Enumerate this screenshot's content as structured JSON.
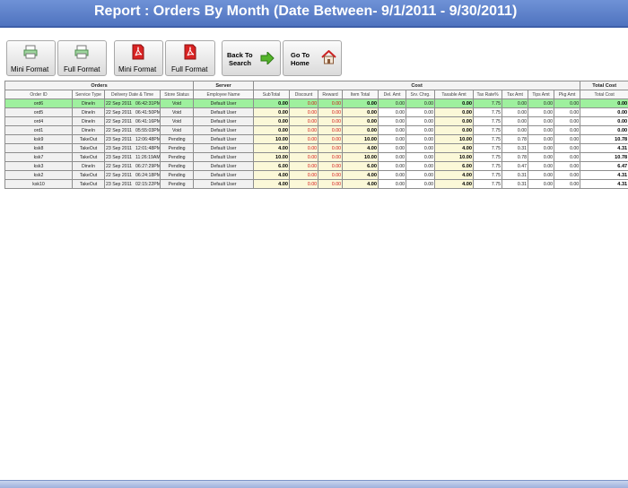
{
  "title": "Report :  Orders By Month (Date Between- 9/1/2011 - 9/30/2011)",
  "toolbar": {
    "buttons": [
      {
        "label": "Mini Format",
        "icon": "printer-icon"
      },
      {
        "label": "Full Format",
        "icon": "printer-icon"
      },
      {
        "label": "Mini Format",
        "icon": "pdf-icon"
      },
      {
        "label": "Full Format",
        "icon": "pdf-icon"
      },
      {
        "label": "Back To Search",
        "line1": "Back To",
        "line2": "Search",
        "icon": "arrow-right-icon"
      },
      {
        "label": "Go To Home",
        "line1": "Go To",
        "line2": "Home",
        "icon": "home-icon"
      }
    ]
  },
  "groups": {
    "orders": "Orders",
    "server": "Server",
    "cost": "Cost",
    "total": "Total Cost"
  },
  "columns": [
    "Order ID",
    "Service Type",
    "Delivery Date & Time",
    "Store Status",
    "Employee Name",
    "SubTotal",
    "Discount",
    "Reward",
    "Item Total",
    "Del. Amt",
    "Srv. Chrg.",
    "Taxable Amt",
    "Tax Rate%",
    "Tax Amt",
    "Tips Amt",
    "Pkg Amt",
    "Total Cost"
  ],
  "rows": [
    {
      "id": "ord6",
      "service": "DineIn",
      "date": "22 Sep 2011",
      "time": "06:42:31PM",
      "status": "Void",
      "employee": "Default User",
      "subtotal": "0.00",
      "discount": "0.00",
      "reward": "0.00",
      "item_total": "0.00",
      "del": "0.00",
      "srv": "0.00",
      "taxable": "0.00",
      "tax_rate": "7.75",
      "tax_amt": "0.00",
      "tips": "0.00",
      "pkg": "0.00",
      "total": "0.00"
    },
    {
      "id": "ord5",
      "service": "DineIn",
      "date": "22 Sep 2011",
      "time": "06:41:50PM",
      "status": "Void",
      "employee": "Default User",
      "subtotal": "0.00",
      "discount": "0.00",
      "reward": "0.00",
      "item_total": "0.00",
      "del": "0.00",
      "srv": "0.00",
      "taxable": "0.00",
      "tax_rate": "7.75",
      "tax_amt": "0.00",
      "tips": "0.00",
      "pkg": "0.00",
      "total": "0.00"
    },
    {
      "id": "ord4",
      "service": "DineIn",
      "date": "22 Sep 2011",
      "time": "06:41:16PM",
      "status": "Void",
      "employee": "Default User",
      "subtotal": "0.00",
      "discount": "0.00",
      "reward": "0.00",
      "item_total": "0.00",
      "del": "0.00",
      "srv": "0.00",
      "taxable": "0.00",
      "tax_rate": "7.75",
      "tax_amt": "0.00",
      "tips": "0.00",
      "pkg": "0.00",
      "total": "0.00"
    },
    {
      "id": "ord1",
      "service": "DineIn",
      "date": "22 Sep 2011",
      "time": "05:55:03PM",
      "status": "Void",
      "employee": "Default User",
      "subtotal": "0.00",
      "discount": "0.00",
      "reward": "0.00",
      "item_total": "0.00",
      "del": "0.00",
      "srv": "0.00",
      "taxable": "0.00",
      "tax_rate": "7.75",
      "tax_amt": "0.00",
      "tips": "0.00",
      "pkg": "0.00",
      "total": "0.00"
    },
    {
      "id": "ksk9",
      "service": "TakeOut",
      "date": "23 Sep 2011",
      "time": "12:06:48PM",
      "status": "Pending",
      "employee": "Default User",
      "subtotal": "10.00",
      "discount": "0.00",
      "reward": "0.00",
      "item_total": "10.00",
      "del": "0.00",
      "srv": "0.00",
      "taxable": "10.00",
      "tax_rate": "7.75",
      "tax_amt": "0.78",
      "tips": "0.00",
      "pkg": "0.00",
      "total": "10.78"
    },
    {
      "id": "ksk8",
      "service": "TakeOut",
      "date": "23 Sep 2011",
      "time": "12:01:48PM",
      "status": "Pending",
      "employee": "Default User",
      "subtotal": "4.00",
      "discount": "0.00",
      "reward": "0.00",
      "item_total": "4.00",
      "del": "0.00",
      "srv": "0.00",
      "taxable": "4.00",
      "tax_rate": "7.75",
      "tax_amt": "0.31",
      "tips": "0.00",
      "pkg": "0.00",
      "total": "4.31"
    },
    {
      "id": "ksk7",
      "service": "TakeOut",
      "date": "23 Sep 2011",
      "time": "11:26:19AM",
      "status": "Pending",
      "employee": "Default User",
      "subtotal": "10.00",
      "discount": "0.00",
      "reward": "0.00",
      "item_total": "10.00",
      "del": "0.00",
      "srv": "0.00",
      "taxable": "10.00",
      "tax_rate": "7.75",
      "tax_amt": "0.78",
      "tips": "0.00",
      "pkg": "0.00",
      "total": "10.78"
    },
    {
      "id": "ksk3",
      "service": "DineIn",
      "date": "22 Sep 2011",
      "time": "06:27:29PM",
      "status": "Pending",
      "employee": "Default User",
      "subtotal": "6.00",
      "discount": "0.00",
      "reward": "0.00",
      "item_total": "6.00",
      "del": "0.00",
      "srv": "0.00",
      "taxable": "6.00",
      "tax_rate": "7.75",
      "tax_amt": "0.47",
      "tips": "0.00",
      "pkg": "0.00",
      "total": "6.47"
    },
    {
      "id": "ksk2",
      "service": "TakeOut",
      "date": "22 Sep 2011",
      "time": "06:24:18PM",
      "status": "Pending",
      "employee": "Default User",
      "subtotal": "4.00",
      "discount": "0.00",
      "reward": "0.00",
      "item_total": "4.00",
      "del": "0.00",
      "srv": "0.00",
      "taxable": "4.00",
      "tax_rate": "7.75",
      "tax_amt": "0.31",
      "tips": "0.00",
      "pkg": "0.00",
      "total": "4.31"
    },
    {
      "id": "ksk10",
      "service": "TakeOut",
      "date": "23 Sep 2011",
      "time": "02:15:22PM",
      "status": "Pending",
      "employee": "Default User",
      "subtotal": "4.00",
      "discount": "0.00",
      "reward": "0.00",
      "item_total": "4.00",
      "del": "0.00",
      "srv": "0.00",
      "taxable": "4.00",
      "tax_rate": "7.75",
      "tax_amt": "0.31",
      "tips": "0.00",
      "pkg": "0.00",
      "total": "4.31"
    }
  ],
  "colors": {
    "title_bg": "#5a7cc6",
    "selected_row": "#9ef09e",
    "cost_cell": "#fbf8d8",
    "discount_text": "#d01010"
  }
}
